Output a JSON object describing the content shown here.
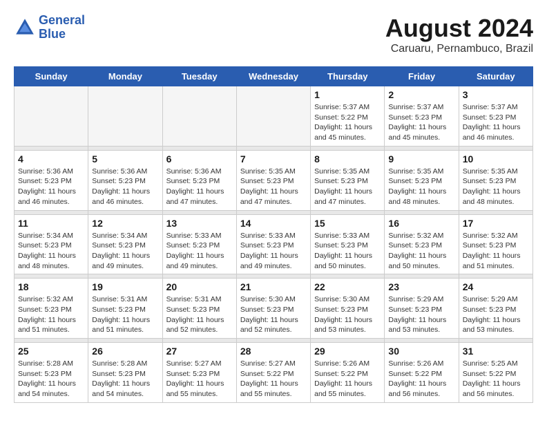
{
  "header": {
    "logo_line1": "General",
    "logo_line2": "Blue",
    "main_title": "August 2024",
    "subtitle": "Caruaru, Pernambuco, Brazil"
  },
  "days_of_week": [
    "Sunday",
    "Monday",
    "Tuesday",
    "Wednesday",
    "Thursday",
    "Friday",
    "Saturday"
  ],
  "weeks": [
    {
      "days": [
        {
          "num": "",
          "info": ""
        },
        {
          "num": "",
          "info": ""
        },
        {
          "num": "",
          "info": ""
        },
        {
          "num": "",
          "info": ""
        },
        {
          "num": "1",
          "info": "Sunrise: 5:37 AM\nSunset: 5:22 PM\nDaylight: 11 hours\nand 45 minutes."
        },
        {
          "num": "2",
          "info": "Sunrise: 5:37 AM\nSunset: 5:23 PM\nDaylight: 11 hours\nand 45 minutes."
        },
        {
          "num": "3",
          "info": "Sunrise: 5:37 AM\nSunset: 5:23 PM\nDaylight: 11 hours\nand 46 minutes."
        }
      ]
    },
    {
      "days": [
        {
          "num": "4",
          "info": "Sunrise: 5:36 AM\nSunset: 5:23 PM\nDaylight: 11 hours\nand 46 minutes."
        },
        {
          "num": "5",
          "info": "Sunrise: 5:36 AM\nSunset: 5:23 PM\nDaylight: 11 hours\nand 46 minutes."
        },
        {
          "num": "6",
          "info": "Sunrise: 5:36 AM\nSunset: 5:23 PM\nDaylight: 11 hours\nand 47 minutes."
        },
        {
          "num": "7",
          "info": "Sunrise: 5:35 AM\nSunset: 5:23 PM\nDaylight: 11 hours\nand 47 minutes."
        },
        {
          "num": "8",
          "info": "Sunrise: 5:35 AM\nSunset: 5:23 PM\nDaylight: 11 hours\nand 47 minutes."
        },
        {
          "num": "9",
          "info": "Sunrise: 5:35 AM\nSunset: 5:23 PM\nDaylight: 11 hours\nand 48 minutes."
        },
        {
          "num": "10",
          "info": "Sunrise: 5:35 AM\nSunset: 5:23 PM\nDaylight: 11 hours\nand 48 minutes."
        }
      ]
    },
    {
      "days": [
        {
          "num": "11",
          "info": "Sunrise: 5:34 AM\nSunset: 5:23 PM\nDaylight: 11 hours\nand 48 minutes."
        },
        {
          "num": "12",
          "info": "Sunrise: 5:34 AM\nSunset: 5:23 PM\nDaylight: 11 hours\nand 49 minutes."
        },
        {
          "num": "13",
          "info": "Sunrise: 5:33 AM\nSunset: 5:23 PM\nDaylight: 11 hours\nand 49 minutes."
        },
        {
          "num": "14",
          "info": "Sunrise: 5:33 AM\nSunset: 5:23 PM\nDaylight: 11 hours\nand 49 minutes."
        },
        {
          "num": "15",
          "info": "Sunrise: 5:33 AM\nSunset: 5:23 PM\nDaylight: 11 hours\nand 50 minutes."
        },
        {
          "num": "16",
          "info": "Sunrise: 5:32 AM\nSunset: 5:23 PM\nDaylight: 11 hours\nand 50 minutes."
        },
        {
          "num": "17",
          "info": "Sunrise: 5:32 AM\nSunset: 5:23 PM\nDaylight: 11 hours\nand 51 minutes."
        }
      ]
    },
    {
      "days": [
        {
          "num": "18",
          "info": "Sunrise: 5:32 AM\nSunset: 5:23 PM\nDaylight: 11 hours\nand 51 minutes."
        },
        {
          "num": "19",
          "info": "Sunrise: 5:31 AM\nSunset: 5:23 PM\nDaylight: 11 hours\nand 51 minutes."
        },
        {
          "num": "20",
          "info": "Sunrise: 5:31 AM\nSunset: 5:23 PM\nDaylight: 11 hours\nand 52 minutes."
        },
        {
          "num": "21",
          "info": "Sunrise: 5:30 AM\nSunset: 5:23 PM\nDaylight: 11 hours\nand 52 minutes."
        },
        {
          "num": "22",
          "info": "Sunrise: 5:30 AM\nSunset: 5:23 PM\nDaylight: 11 hours\nand 53 minutes."
        },
        {
          "num": "23",
          "info": "Sunrise: 5:29 AM\nSunset: 5:23 PM\nDaylight: 11 hours\nand 53 minutes."
        },
        {
          "num": "24",
          "info": "Sunrise: 5:29 AM\nSunset: 5:23 PM\nDaylight: 11 hours\nand 53 minutes."
        }
      ]
    },
    {
      "days": [
        {
          "num": "25",
          "info": "Sunrise: 5:28 AM\nSunset: 5:23 PM\nDaylight: 11 hours\nand 54 minutes."
        },
        {
          "num": "26",
          "info": "Sunrise: 5:28 AM\nSunset: 5:23 PM\nDaylight: 11 hours\nand 54 minutes."
        },
        {
          "num": "27",
          "info": "Sunrise: 5:27 AM\nSunset: 5:23 PM\nDaylight: 11 hours\nand 55 minutes."
        },
        {
          "num": "28",
          "info": "Sunrise: 5:27 AM\nSunset: 5:22 PM\nDaylight: 11 hours\nand 55 minutes."
        },
        {
          "num": "29",
          "info": "Sunrise: 5:26 AM\nSunset: 5:22 PM\nDaylight: 11 hours\nand 55 minutes."
        },
        {
          "num": "30",
          "info": "Sunrise: 5:26 AM\nSunset: 5:22 PM\nDaylight: 11 hours\nand 56 minutes."
        },
        {
          "num": "31",
          "info": "Sunrise: 5:25 AM\nSunset: 5:22 PM\nDaylight: 11 hours\nand 56 minutes."
        }
      ]
    }
  ]
}
